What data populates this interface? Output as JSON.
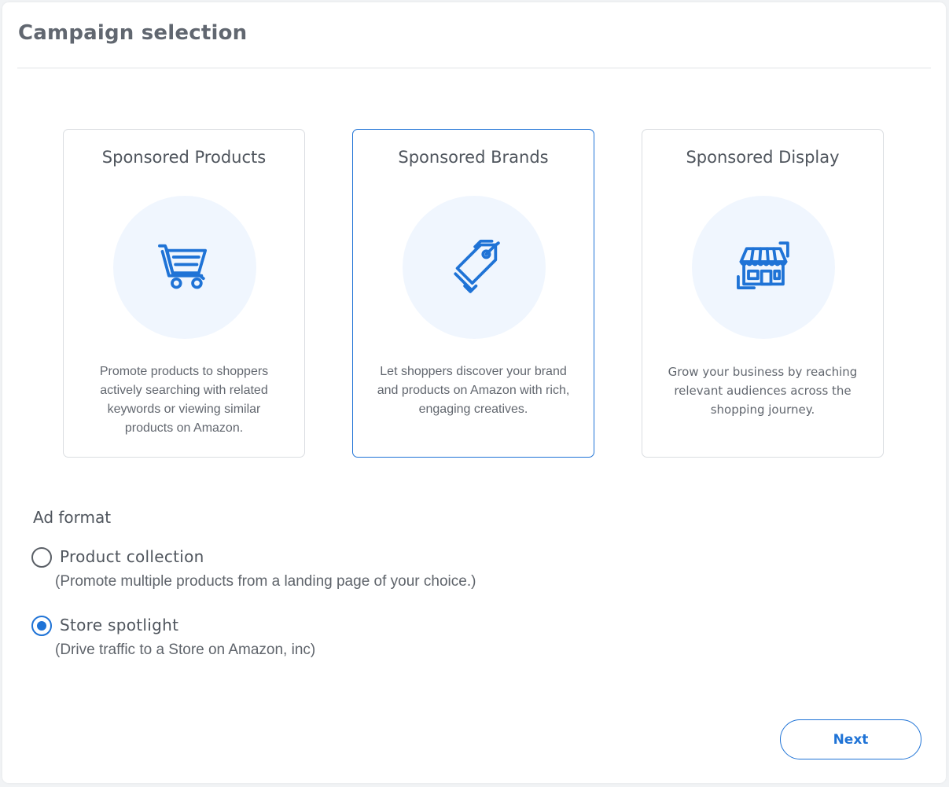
{
  "page": {
    "title": "Campaign selection"
  },
  "campaign_types": [
    {
      "title": "Sponsored Products",
      "description": "Promote products to shoppers actively searching with related keywords or viewing similar products on Amazon.",
      "icon": "shopping-cart-icon",
      "selected": false
    },
    {
      "title": "Sponsored Brands",
      "description": "Let shoppers discover your brand and products on Amazon with rich, engaging creatives.",
      "icon": "price-tag-icon",
      "selected": true
    },
    {
      "title": "Sponsored Display",
      "description": "Grow your business by reaching relevant audiences across the shopping journey.",
      "icon": "storefront-icon",
      "selected": false
    }
  ],
  "ad_format": {
    "title": "Ad format",
    "options": [
      {
        "label": "Product collection",
        "help": "(Promote multiple products from a landing page of your choice.)",
        "checked": false
      },
      {
        "label": "Store spotlight",
        "help": "(Drive traffic to a Store on Amazon, inc)",
        "checked": true
      }
    ]
  },
  "actions": {
    "next_label": "Next"
  },
  "colors": {
    "accent": "#1f73d6",
    "icon_circle_bg": "#f0f6fe",
    "card_border": "#dadde1",
    "text": "#4f555d"
  }
}
